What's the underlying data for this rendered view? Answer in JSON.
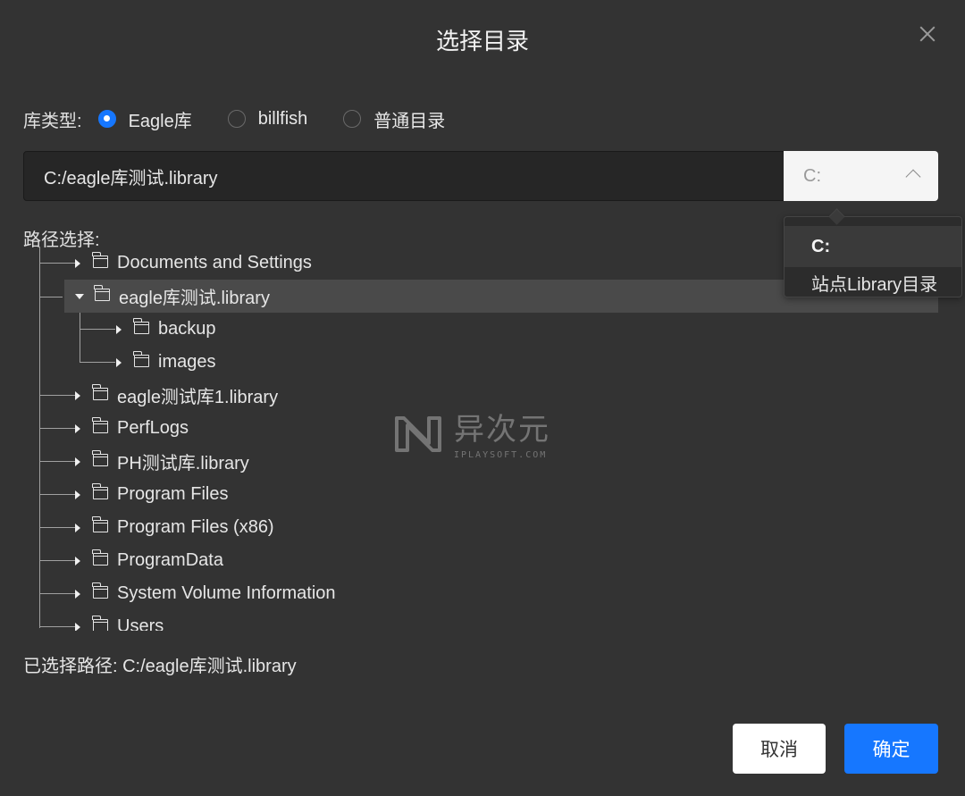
{
  "dialog": {
    "title": "选择目录"
  },
  "library_type": {
    "label": "库类型:",
    "options": [
      {
        "label": "Eagle库",
        "checked": true
      },
      {
        "label": "billfish",
        "checked": false
      },
      {
        "label": "普通目录",
        "checked": false
      }
    ]
  },
  "path_input": {
    "value": "C:/eagle库测试.library"
  },
  "drive_select": {
    "value": "C:",
    "options": [
      "C:",
      "站点Library目录"
    ]
  },
  "tree": {
    "label": "路径选择:",
    "nodes": [
      {
        "label": "Documents and Settings",
        "expanded": false
      },
      {
        "label": "eagle库测试.library",
        "expanded": true,
        "selected": true
      },
      {
        "label": "backup",
        "expanded": false,
        "child": true
      },
      {
        "label": "images",
        "expanded": false,
        "child": true
      },
      {
        "label": "eagle测试库1.library",
        "expanded": false
      },
      {
        "label": "PerfLogs",
        "expanded": false
      },
      {
        "label": "PH测试库.library",
        "expanded": false
      },
      {
        "label": "Program Files",
        "expanded": false
      },
      {
        "label": "Program Files (x86)",
        "expanded": false
      },
      {
        "label": "ProgramData",
        "expanded": false
      },
      {
        "label": "System Volume Information",
        "expanded": false
      },
      {
        "label": "Users",
        "expanded": false
      }
    ]
  },
  "selected_path": {
    "text": "已选择路径:  C:/eagle库测试.library"
  },
  "watermark": {
    "cn": "异次元",
    "en": "IPLAYSOFT.COM"
  },
  "buttons": {
    "cancel": "取消",
    "ok": "确定"
  },
  "colors": {
    "accent": "#1677ff",
    "background": "#333333"
  }
}
